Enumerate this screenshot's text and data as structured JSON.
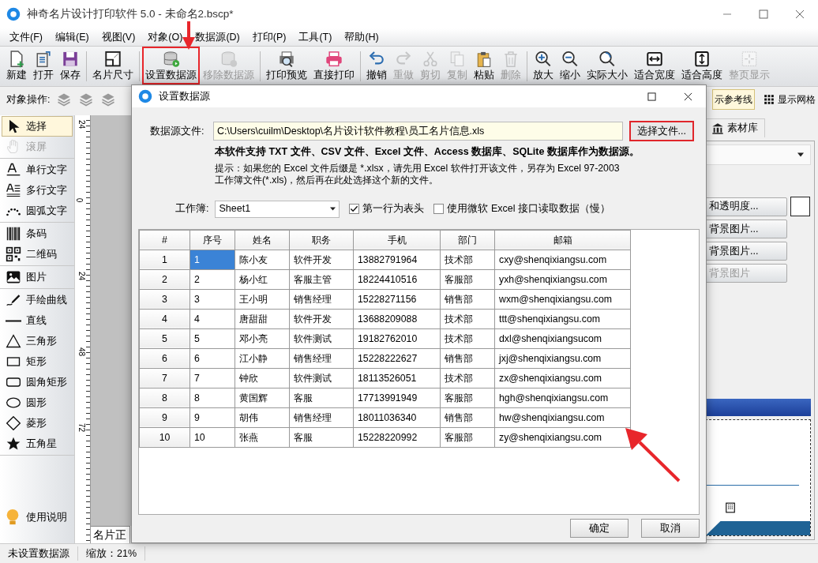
{
  "window": {
    "title": "神奇名片设计打印软件 5.0 - 未命名2.bscp*"
  },
  "menu": [
    "文件(F)",
    "编辑(E)",
    "视图(V)",
    "对象(O)",
    "数据源(D)",
    "打印(P)",
    "工具(T)",
    "帮助(H)"
  ],
  "toolbar": [
    [
      {
        "label": "新建",
        "disabled": false,
        "highlighted": false
      },
      {
        "label": "打开",
        "disabled": false,
        "highlighted": false
      },
      {
        "label": "保存",
        "disabled": false,
        "highlighted": false
      }
    ],
    [
      {
        "label": "名片尺寸",
        "disabled": false,
        "highlighted": false
      }
    ],
    [
      {
        "label": "设置数据源",
        "disabled": false,
        "highlighted": true
      },
      {
        "label": "移除数据源",
        "disabled": true,
        "highlighted": false
      }
    ],
    [
      {
        "label": "打印预览",
        "disabled": false,
        "highlighted": false
      },
      {
        "label": "直接打印",
        "disabled": false,
        "highlighted": false
      }
    ],
    [
      {
        "label": "撤销",
        "disabled": false,
        "highlighted": false
      },
      {
        "label": "重做",
        "disabled": true,
        "highlighted": false
      },
      {
        "label": "剪切",
        "disabled": true,
        "highlighted": false
      },
      {
        "label": "复制",
        "disabled": true,
        "highlighted": false
      },
      {
        "label": "粘贴",
        "disabled": false,
        "highlighted": false
      },
      {
        "label": "删除",
        "disabled": true,
        "highlighted": false
      }
    ],
    [
      {
        "label": "放大",
        "disabled": false,
        "highlighted": false
      },
      {
        "label": "缩小",
        "disabled": false,
        "highlighted": false
      },
      {
        "label": "实际大小",
        "disabled": false,
        "highlighted": false
      },
      {
        "label": "适合宽度",
        "disabled": false,
        "highlighted": false
      },
      {
        "label": "适合高度",
        "disabled": false,
        "highlighted": false
      },
      {
        "label": "整页显示",
        "disabled": true,
        "highlighted": false
      }
    ]
  ],
  "object_bar": {
    "label": "对象操作:"
  },
  "view_toggles": [
    {
      "label": "示参考线",
      "selected": true
    },
    {
      "label": "显示网格",
      "selected": false
    }
  ],
  "tools": [
    [
      {
        "label": "选择",
        "selected": true,
        "disabled": false
      },
      {
        "label": "滚屏",
        "selected": false,
        "disabled": true
      }
    ],
    [
      {
        "label": "单行文字",
        "selected": false,
        "disabled": false
      },
      {
        "label": "多行文字",
        "selected": false,
        "disabled": false
      },
      {
        "label": "圆弧文字",
        "selected": false,
        "disabled": false
      }
    ],
    [
      {
        "label": "条码",
        "selected": false,
        "disabled": false
      },
      {
        "label": "二维码",
        "selected": false,
        "disabled": false
      }
    ],
    [
      {
        "label": "图片",
        "selected": false,
        "disabled": false
      }
    ],
    [
      {
        "label": "手绘曲线",
        "selected": false,
        "disabled": false
      },
      {
        "label": "直线",
        "selected": false,
        "disabled": false
      },
      {
        "label": "三角形",
        "selected": false,
        "disabled": false
      },
      {
        "label": "矩形",
        "selected": false,
        "disabled": false
      },
      {
        "label": "圆角矩形",
        "selected": false,
        "disabled": false
      },
      {
        "label": "圆形",
        "selected": false,
        "disabled": false
      },
      {
        "label": "菱形",
        "selected": false,
        "disabled": false
      },
      {
        "label": "五角星",
        "selected": false,
        "disabled": false
      }
    ]
  ],
  "help": {
    "label": "使用说明"
  },
  "ruler": {
    "labels": [
      "24",
      "0",
      "24",
      "48",
      "72"
    ]
  },
  "canvas_tab": {
    "label": "名片正"
  },
  "right_panel": {
    "tab": "素材库",
    "buttons": [
      {
        "label": "和透明度...",
        "disabled": false
      },
      {
        "label": "背景图片...",
        "disabled": false
      },
      {
        "label": "背景图片...",
        "disabled": false
      },
      {
        "label": "背景图片",
        "disabled": true
      }
    ]
  },
  "status_bar": [
    "未设置数据源",
    "缩放：21%"
  ],
  "dialog": {
    "title": "设置数据源",
    "source_label": "数据源文件:",
    "source_path": "C:\\Users\\cuilm\\Desktop\\名片设计软件教程\\员工名片信息.xls",
    "choose_button": {
      "label": "选择文件...",
      "highlighted": true
    },
    "support_note": "本软件支持 TXT 文件、CSV 文件、Excel 文件、Access 数据库、SQLite 数据库作为数据源。",
    "hint": "提示：如果您的 Excel 文件后缀是 *.xlsx，请先用 Excel 软件打开该文件，另存为 Excel 97-2003 工作簿文件(*.xls)，然后再在此处选择这个新的文件。",
    "workbook_label": "工作簿:",
    "workbook": "Sheet1",
    "options": [
      {
        "label": "第一行为表头",
        "checked": true
      },
      {
        "label": "使用微软 Excel 接口读取数据（慢）",
        "checked": false
      }
    ],
    "table": {
      "columns": [
        "#",
        "序号",
        "姓名",
        "职务",
        "手机",
        "部门",
        "邮箱"
      ],
      "rows": [
        {
          "selected": true,
          "cells": [
            "1",
            "1",
            "陈小友",
            "软件开发",
            "13882791964",
            "技术部",
            "cxy@shenqixiangsu.com"
          ]
        },
        {
          "selected": false,
          "cells": [
            "2",
            "2",
            "杨小红",
            "客服主管",
            "18224410516",
            "客服部",
            "yxh@shenqixiangsu.com"
          ]
        },
        {
          "selected": false,
          "cells": [
            "3",
            "3",
            "王小明",
            "销售经理",
            "15228271156",
            "销售部",
            "wxm@shenqixiangsu.com"
          ]
        },
        {
          "selected": false,
          "cells": [
            "4",
            "4",
            "唐甜甜",
            "软件开发",
            "13688209088",
            "技术部",
            "ttt@shenqixiangsu.com"
          ]
        },
        {
          "selected": false,
          "cells": [
            "5",
            "5",
            "邓小亮",
            "软件测试",
            "19182762010",
            "技术部",
            "dxl@shenqixiangsucom"
          ]
        },
        {
          "selected": false,
          "cells": [
            "6",
            "6",
            "江小静",
            "销售经理",
            "15228222627",
            "销售部",
            "jxj@shenqixiangsu.com"
          ]
        },
        {
          "selected": false,
          "cells": [
            "7",
            "7",
            "钟欣",
            "软件测试",
            "18113526051",
            "技术部",
            "zx@shenqixiangsu.com"
          ]
        },
        {
          "selected": false,
          "cells": [
            "8",
            "8",
            "黄国辉",
            "客服",
            "17713991949",
            "客服部",
            "hgh@shenqixiangsu.com"
          ]
        },
        {
          "selected": false,
          "cells": [
            "9",
            "9",
            "胡伟",
            "销售经理",
            "18011036340",
            "销售部",
            "hw@shenqixiangsu.com"
          ]
        },
        {
          "selected": false,
          "cells": [
            "10",
            "10",
            "张燕",
            "客服",
            "15228220992",
            "客服部",
            "zy@shenqixiangsu.com"
          ]
        }
      ]
    },
    "buttons": [
      "确定",
      "取消"
    ]
  }
}
